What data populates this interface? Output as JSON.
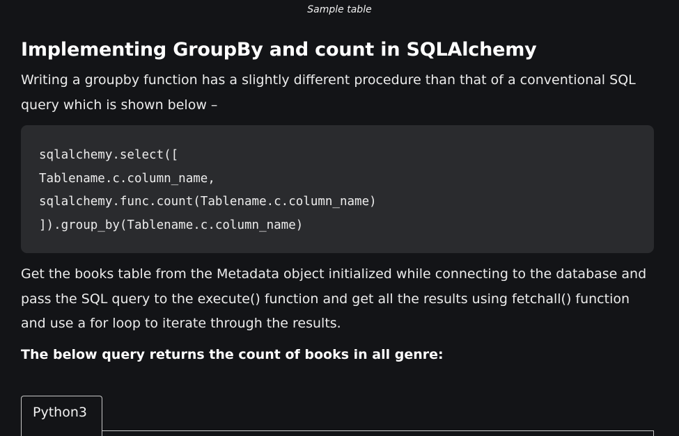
{
  "caption": "Sample table",
  "article": {
    "heading": "Implementing GroupBy and count in SQLAlchemy",
    "intro": "Writing a groupby function has a slightly different procedure than that of a conventional SQL query which is  shown below –",
    "code": {
      "line1": "sqlalchemy.select([",
      "line2": "Tablename.c.column_name,",
      "line3": "sqlalchemy.func.count(Tablename.c.column_name)",
      "line4": "]).group_by(Tablename.c.column_name)"
    },
    "body": "Get the books table from the Metadata object initialized while connecting to the database and pass the SQL query to the execute() function and get all the results using fetchall() function and use a for loop to iterate through the results.",
    "bold_note": "The below query returns the count of books in all genre:"
  },
  "tabs": {
    "active_label": "Python3"
  }
}
